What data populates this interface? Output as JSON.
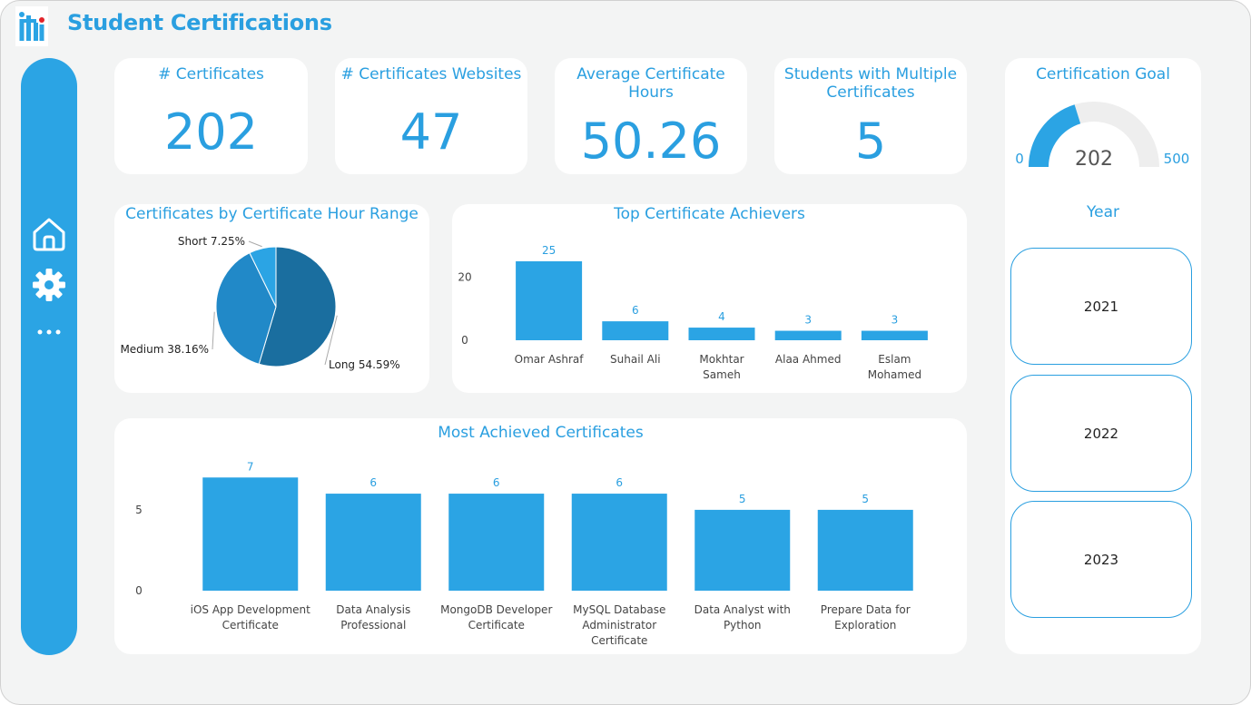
{
  "header": {
    "logo_text": "iti",
    "title": "Student Certifications"
  },
  "sidebar": {
    "items": [
      {
        "icon": "home-icon"
      },
      {
        "icon": "gear-icon"
      },
      {
        "icon": "more-icon"
      }
    ]
  },
  "colors": {
    "accent": "#2ba4e4",
    "pie_long": "#1a6e9f",
    "pie_medium": "#2189c8",
    "pie_short": "#2ba4e4",
    "gauge_track": "#eeeeee",
    "background": "#f3f4f4"
  },
  "kpis": [
    {
      "label": "# Certificates",
      "value": "202"
    },
    {
      "label": "# Certificates Websites",
      "value": "47"
    },
    {
      "label": "Average Certificate Hours",
      "value": "50.26"
    },
    {
      "label": "Students with Multiple Certificates",
      "value": "5"
    }
  ],
  "gauge": {
    "title": "Certification Goal",
    "min": "0",
    "max": "500",
    "value": "202",
    "value_num": 202,
    "max_num": 500
  },
  "year_slicer": {
    "title": "Year",
    "options": [
      "2021",
      "2022",
      "2023"
    ]
  },
  "chart_data": [
    {
      "type": "pie",
      "title": "Certificates by Certificate Hour Range",
      "slices": [
        {
          "name": "Long",
          "value": 54.59,
          "label": "Long 54.59%"
        },
        {
          "name": "Medium",
          "value": 38.16,
          "label": "Medium 38.16%"
        },
        {
          "name": "Short",
          "value": 7.25,
          "label": "Short 7.25%"
        }
      ]
    },
    {
      "type": "bar",
      "title": "Top Certificate Achievers",
      "categories": [
        "Omar Ashraf",
        "Suhail Ali",
        "Mokhtar Sameh",
        "Alaa Ahmed",
        "Eslam Mohamed"
      ],
      "category_lines": [
        [
          "Omar Ashraf"
        ],
        [
          "Suhail Ali"
        ],
        [
          "Mokhtar",
          "Sameh"
        ],
        [
          "Alaa Ahmed"
        ],
        [
          "Eslam",
          "Mohamed"
        ]
      ],
      "values": [
        25,
        6,
        4,
        3,
        3
      ],
      "yticks": [
        "0",
        "20"
      ],
      "ylim": [
        0,
        27
      ]
    },
    {
      "type": "bar",
      "title": "Most Achieved Certificates",
      "categories": [
        "iOS App Development Certificate",
        "Data Analysis Professional",
        "MongoDB Developer Certificate",
        "MySQL Database Administrator Certificate",
        "Data Analyst with Python",
        "Prepare Data for Exploration"
      ],
      "category_lines": [
        [
          "iOS App Development",
          "Certificate"
        ],
        [
          "Data Analysis",
          "Professional"
        ],
        [
          "MongoDB Developer",
          "Certificate"
        ],
        [
          "MySQL Database",
          "Administrator",
          "Certificate"
        ],
        [
          "Data Analyst with",
          "Python"
        ],
        [
          "Prepare Data for",
          "Exploration"
        ]
      ],
      "values": [
        7,
        6,
        6,
        6,
        5,
        5
      ],
      "yticks": [
        "0",
        "5"
      ],
      "ylim": [
        0,
        7.8
      ]
    }
  ]
}
